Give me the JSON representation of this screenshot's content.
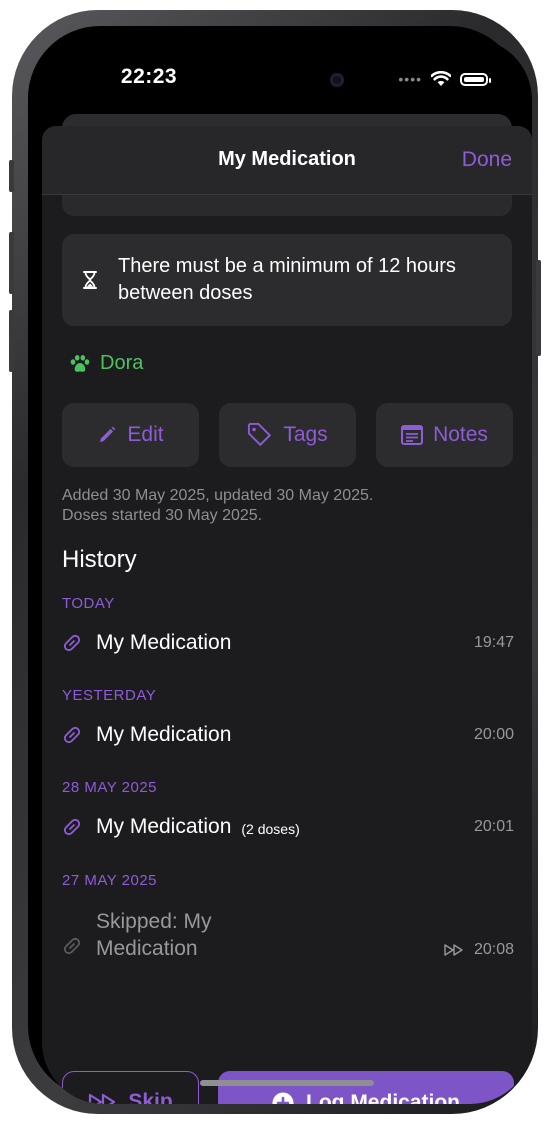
{
  "status": {
    "time": "22:23",
    "signal_dots": "••••"
  },
  "nav": {
    "title": "My Medication",
    "done_label": "Done"
  },
  "info": {
    "text": "There must be a minimum of 12 hours between doses"
  },
  "pet": {
    "name": "Dora"
  },
  "actions": [
    {
      "label": "Edit",
      "icon": "pencil-icon"
    },
    {
      "label": "Tags",
      "icon": "tag-icon"
    },
    {
      "label": "Notes",
      "icon": "notes-icon"
    }
  ],
  "meta": {
    "line1": "Added 30 May 2025, updated 30 May 2025.",
    "line2": "Doses started 30 May 2025."
  },
  "history": {
    "title": "History",
    "sections": [
      {
        "heading": "TODAY",
        "entry": {
          "name": "My Medication",
          "doses": "",
          "time": "19:47"
        }
      },
      {
        "heading": "YESTERDAY",
        "entry": {
          "name": "My Medication",
          "doses": "",
          "time": "20:00"
        }
      },
      {
        "heading": "28 MAY 2025",
        "entry": {
          "name": "My Medication",
          "doses": "(2 doses)",
          "time": "20:01"
        }
      },
      {
        "heading": "27 MAY 2025",
        "entry": {
          "name": "Skipped: My Medication",
          "doses": "",
          "time": "20:08",
          "skipped": true
        }
      }
    ]
  },
  "buttons": {
    "skip_label": "Skip",
    "log_label": "Log Medication"
  },
  "colors": {
    "accent": "#8e5cd6",
    "accent_fill": "#7d55c7",
    "pet_green": "#4cc25e",
    "background": "#1c1c1e"
  }
}
